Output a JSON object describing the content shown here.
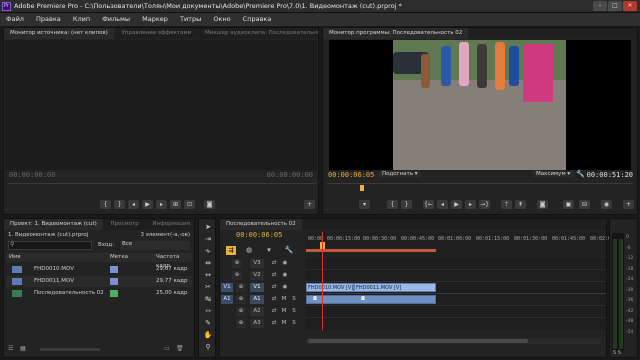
{
  "window": {
    "title": "Adobe Premiere Pro - C:\\Пользователи\\Толян\\Мои документы\\Adobe\\Premiere Pro\\7.0\\1. Видеомонтаж (cut).prproj *",
    "app_badge": "Pr"
  },
  "menu": [
    "Файл",
    "Правка",
    "Клип",
    "Фильмы",
    "Маркер",
    "Титры",
    "Окно",
    "Справка"
  ],
  "source_panel": {
    "tabs": [
      "Монитор источника: (нет клипов)",
      "Управление эффектами",
      "Микшер аудиоклипа: Последовательность"
    ],
    "tc_left": "00:00:00:00",
    "tc_right": "00:00:00:00"
  },
  "program_panel": {
    "tab": "Монитор программы: Последовательность 02",
    "tc_left": "00:00:06:05",
    "fit": "Подогнать",
    "quality": "Максимум",
    "tc_right": "00:00:51:20"
  },
  "project_panel": {
    "tabs": [
      "Проект: 1. Видеомонтаж (cut)",
      "Просмотр",
      "Информация"
    ],
    "file": "1. Видеомонтаж (cut).prproj",
    "count": "3 элемент(-а,-ов)",
    "vhod_label": "Вход:",
    "vhod_value": "Все",
    "columns": [
      "Имя",
      "Метка",
      "Частота кадр"
    ],
    "rows": [
      {
        "name": "FHD0010.MOV",
        "color": "#7e8fd0",
        "rate": "29,67 кадр"
      },
      {
        "name": "FHD0011.MOV",
        "color": "#7e8fd0",
        "rate": "29,77 кадр"
      },
      {
        "name": "Последовательность 02",
        "color": "#4caf62",
        "rate": "25,00 кадр"
      }
    ]
  },
  "timeline": {
    "tab": "Последовательность 02",
    "tc": "00:00:06:05",
    "ruler": [
      "00:00",
      "00:00:15:00",
      "00:00:30:00",
      "00:00:45:00",
      "00:01:00:00",
      "00:01:15:00",
      "00:01:30:00",
      "00:01:45:00",
      "00:02:0"
    ],
    "tracks": [
      {
        "src": "",
        "name": "V3"
      },
      {
        "src": "",
        "name": "V2"
      },
      {
        "src": "V1",
        "name": "V1"
      },
      {
        "src": "A1",
        "name": "A1"
      },
      {
        "src": "",
        "name": "A2"
      },
      {
        "src": "",
        "name": "A3"
      }
    ],
    "clips": [
      "FHD0010.MOV [V]",
      "FHD0011.MOV [V]"
    ]
  },
  "meter": {
    "labels": [
      "0",
      "-6",
      "-12",
      "-18",
      "-24",
      "-30",
      "-36",
      "-42",
      "-48",
      "-54"
    ],
    "bottom": "S S"
  }
}
